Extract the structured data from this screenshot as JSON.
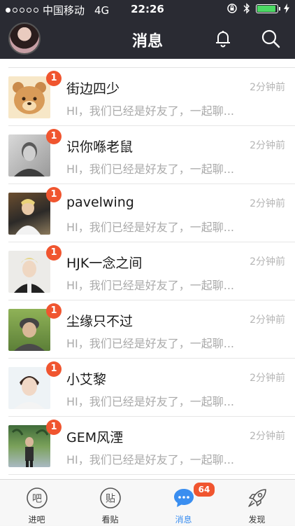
{
  "status_bar": {
    "carrier": "中国移动",
    "network": "4G",
    "time": "22:26"
  },
  "header": {
    "title": "消息"
  },
  "messages": [
    {
      "name": "街边四少",
      "time": "2分钟前",
      "preview": "HI，我们已经是好友了，一起聊...",
      "unread": "1"
    },
    {
      "name": "识你喺老鼠",
      "time": "2分钟前",
      "preview": "HI，我们已经是好友了，一起聊...",
      "unread": "1"
    },
    {
      "name": "pavelwing",
      "time": "2分钟前",
      "preview": "HI，我们已经是好友了，一起聊...",
      "unread": "1"
    },
    {
      "name": "HJK一念之间",
      "time": "2分钟前",
      "preview": "HI，我们已经是好友了，一起聊...",
      "unread": "1"
    },
    {
      "name": "尘缘只不过",
      "time": "2分钟前",
      "preview": "HI，我们已经是好友了，一起聊...",
      "unread": "1"
    },
    {
      "name": "小艾黎",
      "time": "2分钟前",
      "preview": "HI，我们已经是好友了，一起聊...",
      "unread": "1"
    },
    {
      "name": "GEM风湮",
      "time": "2分钟前",
      "preview": "HI，我们已经是好友了，一起聊...",
      "unread": "1"
    }
  ],
  "tabbar": {
    "tabs": [
      {
        "label": "进吧",
        "icon_text": "吧"
      },
      {
        "label": "看贴",
        "icon_text": "贴"
      },
      {
        "label": "消息",
        "badge": "64"
      },
      {
        "label": "发现"
      }
    ]
  },
  "colors": {
    "header_bg": "#2a2b33",
    "badge": "#f0552f",
    "active_tab": "#3a8ef0",
    "battery": "#4cd964"
  }
}
